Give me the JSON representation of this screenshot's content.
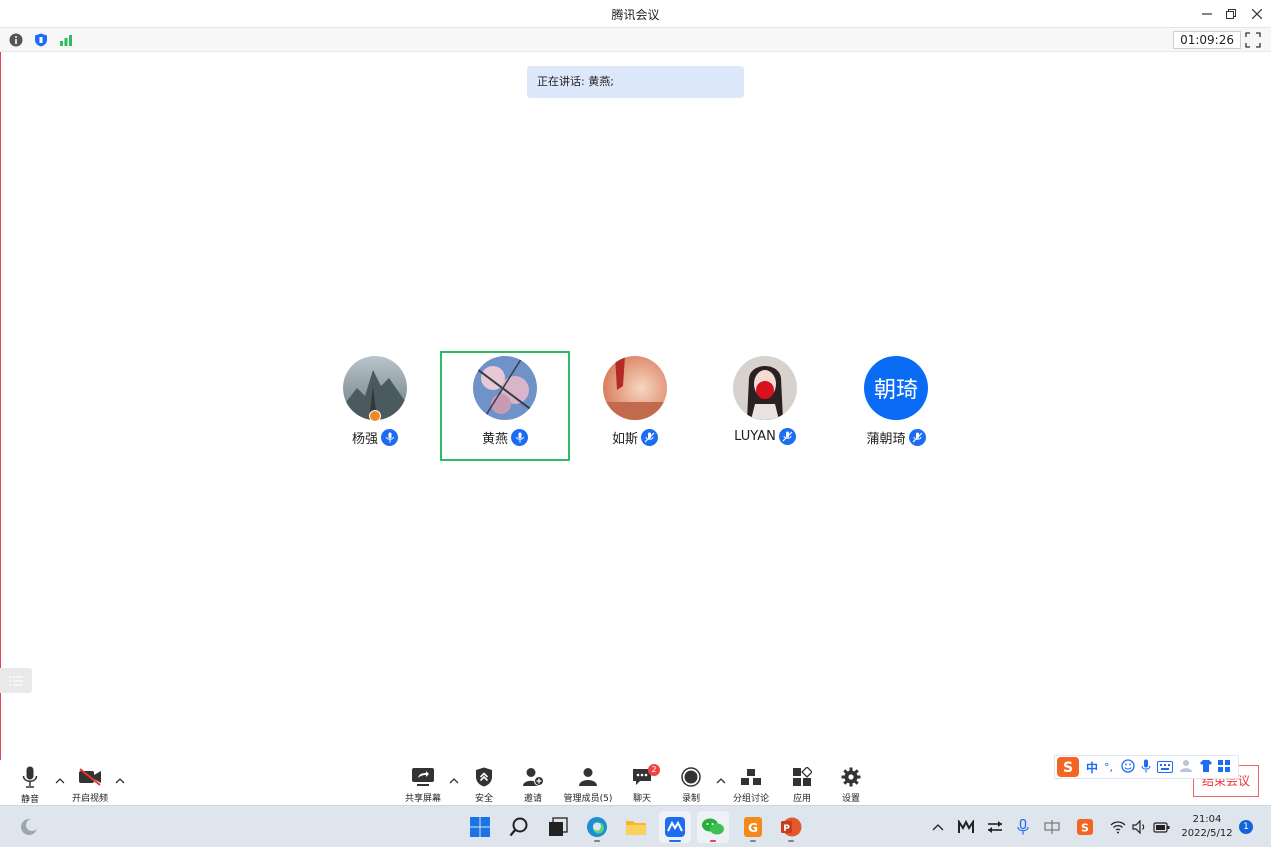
{
  "window": {
    "title": "腾讯会议",
    "timer": "01:09:26"
  },
  "speaking_banner": "正在讲话: 黄燕;",
  "participants": [
    {
      "name": "杨强",
      "avatar": "photo-mountain",
      "mic": "on",
      "host": true,
      "active": false
    },
    {
      "name": "黄燕",
      "avatar": "photo-blossom",
      "mic": "on",
      "host": false,
      "active": true
    },
    {
      "name": "如斯",
      "avatar": "photo-red-sunset",
      "mic": "muted",
      "host": false,
      "active": false
    },
    {
      "name": "LUYAN",
      "avatar": "photo-portrait",
      "mic": "muted",
      "host": false,
      "active": false
    },
    {
      "name": "蒲朝琦",
      "avatar_text": "朝琦",
      "avatar_color": "#0a6cf5",
      "mic": "muted",
      "host": false,
      "active": false
    }
  ],
  "toolbar": {
    "mute": "静音",
    "video": "开启视频",
    "share": "共享屏幕",
    "security": "安全",
    "invite": "邀请",
    "members": "管理成员(5)",
    "chat": "聊天",
    "chat_badge": "2",
    "record": "录制",
    "breakout": "分组讨论",
    "apps": "应用",
    "settings": "设置",
    "end": "结束会议"
  },
  "ime": {
    "mode": "中",
    "punct": "°,"
  },
  "taskbar": {
    "time": "21:04",
    "date": "2022/5/12",
    "notifications": "1"
  },
  "colors": {
    "accent": "#1d6cf2",
    "active_border": "#2dbd61",
    "speaking_bg": "#dde8fb",
    "end_red": "#e33333"
  }
}
